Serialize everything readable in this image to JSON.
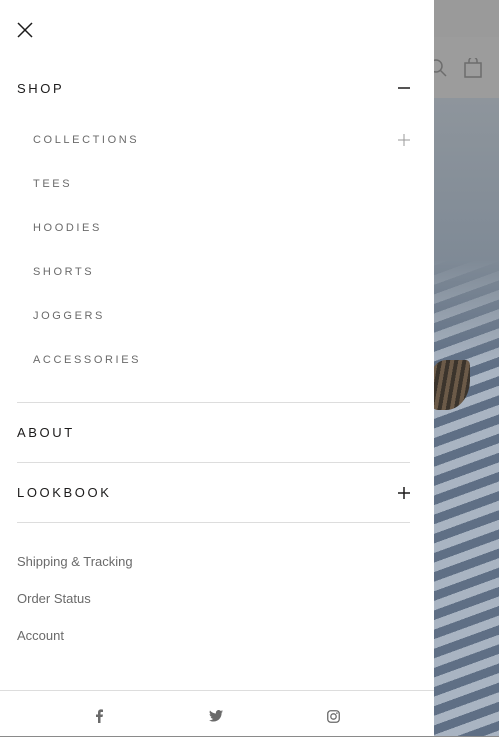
{
  "menu": {
    "shop": {
      "label": "SHOP",
      "items": [
        {
          "label": "COLLECTIONS",
          "expandable": true
        },
        {
          "label": "TEES"
        },
        {
          "label": "HOODIES"
        },
        {
          "label": "SHORTS"
        },
        {
          "label": "JOGGERS"
        },
        {
          "label": "ACCESSORIES"
        }
      ]
    },
    "about": {
      "label": "ABOUT"
    },
    "lookbook": {
      "label": "LOOKBOOK"
    }
  },
  "secondary_links": [
    "Shipping & Tracking",
    "Order Status",
    "Account"
  ],
  "social": [
    "facebook-icon",
    "twitter-icon",
    "instagram-icon"
  ],
  "colors": {
    "heading": "#1c1b1b",
    "muted": "#6a6a6a",
    "divider": "#dddddd"
  }
}
